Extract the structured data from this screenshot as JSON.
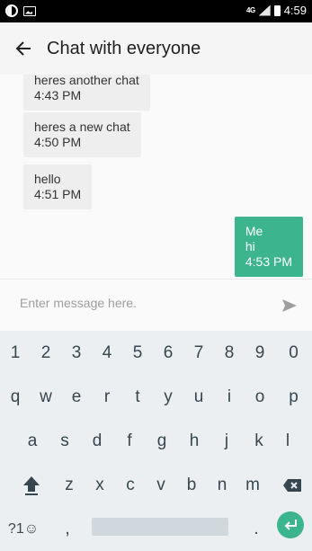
{
  "status_bar": {
    "network": "4G",
    "time": "4:59"
  },
  "app_bar": {
    "title": "Chat with everyone"
  },
  "messages": [
    {
      "text": "heres another chat",
      "time": "4:43 PM",
      "direction": "incoming"
    },
    {
      "text": "heres a new chat",
      "time": "4:50 PM",
      "direction": "incoming"
    },
    {
      "text": "hello",
      "time": "4:51 PM",
      "direction": "incoming"
    },
    {
      "sender": "Me",
      "text": "hi",
      "time": "4:53 PM",
      "direction": "outgoing"
    }
  ],
  "composer": {
    "placeholder": "Enter message here."
  },
  "keyboard": {
    "row1": [
      "1",
      "2",
      "3",
      "4",
      "5",
      "6",
      "7",
      "8",
      "9",
      "0"
    ],
    "row2": [
      "q",
      "w",
      "e",
      "r",
      "t",
      "y",
      "u",
      "i",
      "o",
      "p"
    ],
    "row3": [
      "a",
      "s",
      "d",
      "f",
      "g",
      "h",
      "j",
      "k",
      "l"
    ],
    "row4": [
      "z",
      "x",
      "c",
      "v",
      "b",
      "n",
      "m"
    ],
    "symbols_key": "?1☺",
    "comma_key": ",",
    "period_key": "."
  },
  "colors": {
    "accent": "#3cb58f",
    "keyboard_bg": "#eceff1",
    "incoming_bubble": "#eeeeee"
  }
}
